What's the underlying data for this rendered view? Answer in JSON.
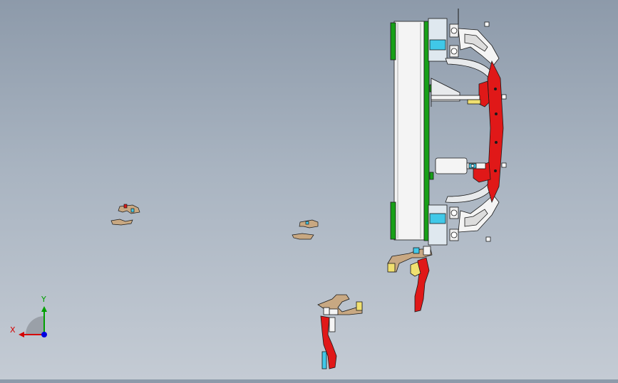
{
  "viewport": {
    "background_top": "#8d9aaa",
    "background_bottom": "#c4cbd4"
  },
  "triad": {
    "x_label": "X",
    "y_label": "Y",
    "x_color": "#d40000",
    "y_color": "#00a000",
    "z_color": "#0000e0"
  },
  "colors": {
    "part_red": "#e01818",
    "part_green": "#18a018",
    "part_tan": "#c8a882",
    "part_yellow": "#f0e070",
    "part_cyan": "#40c8e8",
    "part_white": "#f4f4f4",
    "edge": "#1a1a1a"
  }
}
